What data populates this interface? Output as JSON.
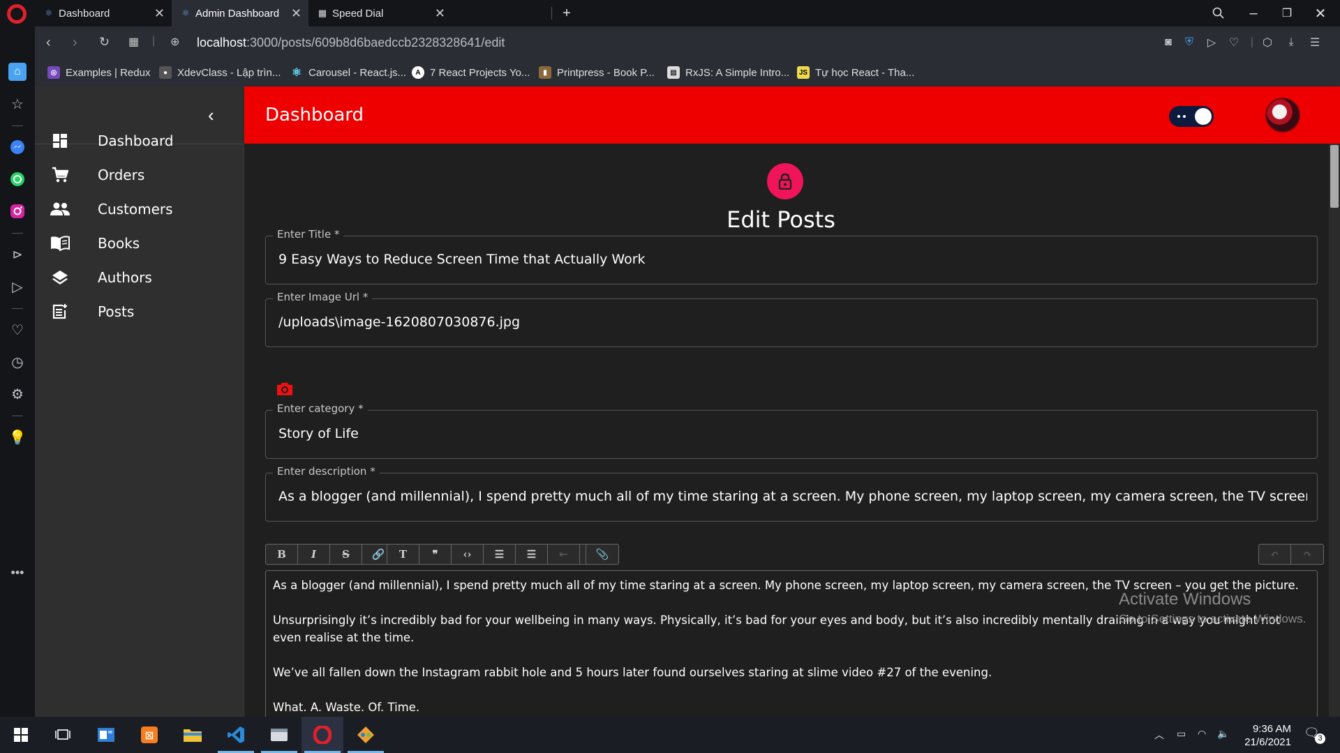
{
  "browser": {
    "tabs": [
      {
        "title": "Dashboard",
        "active": false
      },
      {
        "title": "Admin Dashboard",
        "active": true
      },
      {
        "title": "Speed Dial",
        "active": false
      }
    ],
    "url_host": "localhost",
    "url_path": ":3000/posts/609b8d6baedccb2328328641/edit",
    "bookmarks": [
      {
        "label": "Examples | Redux",
        "icon": "redux-icon",
        "color": "#764abc"
      },
      {
        "label": "XdevClass - Lập trìn...",
        "icon": "xdev-icon",
        "color": "#888888"
      },
      {
        "label": "Carousel - React.js...",
        "icon": "react-icon",
        "color": "#61dafb"
      },
      {
        "label": "7 React Projects Yo...",
        "icon": "a-icon",
        "color": "#222222"
      },
      {
        "label": "Printpress - Book P...",
        "icon": "book-icon",
        "color": "#8a6a3a"
      },
      {
        "label": "RxJS: A Simple Intro...",
        "icon": "page-icon",
        "color": "#dddddd"
      },
      {
        "label": "Tự học React - Tha...",
        "icon": "js-icon",
        "color": "#f0db4f"
      }
    ]
  },
  "app": {
    "title": "Dashboard",
    "nav": [
      {
        "label": "Dashboard",
        "icon": "dashboard-icon"
      },
      {
        "label": "Orders",
        "icon": "cart-icon"
      },
      {
        "label": "Customers",
        "icon": "people-icon"
      },
      {
        "label": "Books",
        "icon": "book-open-icon"
      },
      {
        "label": "Authors",
        "icon": "layers-icon"
      },
      {
        "label": "Posts",
        "icon": "post-add-icon"
      }
    ],
    "accent": "#ee0000",
    "page_title": "Edit Posts",
    "fields": {
      "title": {
        "label": "Enter Title *",
        "value": "9 Easy Ways to Reduce Screen Time that Actually Work"
      },
      "image": {
        "label": "Enter Image Url *",
        "value": "/uploads\\image-1620807030876.jpg"
      },
      "category": {
        "label": "Enter category *",
        "value": "Story of Life"
      },
      "description": {
        "label": "Enter description *",
        "value": "As a blogger (and millennial), I spend pretty much all of my time staring at a screen. My phone screen, my laptop screen, my camera screen, the TV screen – you get the picture."
      }
    },
    "editor_toolbar": {
      "format": [
        "B",
        "I",
        "S",
        "🔗"
      ],
      "block": [
        "T",
        "❞",
        "‹›",
        "☰",
        "☰",
        "⇤",
        "⇥"
      ],
      "attach": [
        "📎"
      ],
      "history": [
        "↶",
        "↷"
      ]
    },
    "editor_paragraphs": [
      "As a blogger (and millennial), I spend pretty much all of my time staring at a screen. My phone screen, my laptop screen, my camera screen, the TV screen – you get the picture.",
      "Unsurprisingly it’s incredibly bad for your wellbeing in many ways. Physically, it’s bad for your eyes and body, but it’s also incredibly mentally draining in a way you might not even realise at the time.",
      "We’ve all fallen down the Instagram rabbit hole and 5 hours later found ourselves staring at slime video #27 of the evening.",
      "What. A. Waste. Of. Time."
    ]
  },
  "watermark": {
    "line1": "Activate Windows",
    "line2": "Go to Settings to activate Windows."
  },
  "taskbar": {
    "time": "9:36 AM",
    "date": "21/6/2021",
    "notifications": "3"
  }
}
